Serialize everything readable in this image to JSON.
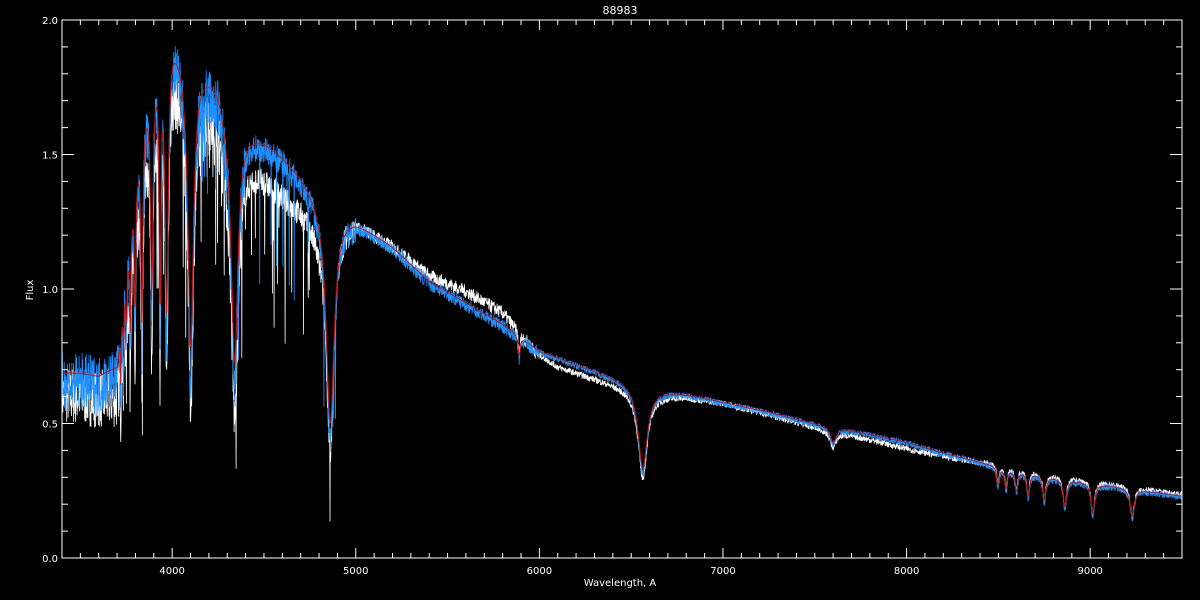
{
  "chart_data": {
    "type": "line",
    "title": "88983",
    "xlabel": "Wavelength, A",
    "ylabel": "Flux",
    "xlim": [
      3400,
      9500
    ],
    "ylim": [
      0.0,
      2.0
    ],
    "x_ticks": [
      4000,
      5000,
      6000,
      7000,
      8000,
      9000
    ],
    "x_tick_labels": [
      "4000",
      "5000",
      "6000",
      "7000",
      "8000",
      "9000"
    ],
    "y_ticks": [
      0.0,
      0.5,
      1.0,
      1.5,
      2.0
    ],
    "y_tick_labels": [
      "0.0",
      "0.5",
      "1.0",
      "1.5",
      "2.0"
    ],
    "x_minor_step": 100,
    "y_minor_step": 0.1,
    "grid": false,
    "colors": {
      "background": "#000000",
      "axes": "#ffffff"
    },
    "continuum": {
      "x": [
        3400,
        3500,
        3600,
        3700,
        3750,
        3800,
        3850,
        3900,
        3950,
        4000,
        4050,
        4100,
        4150,
        4200,
        4250,
        4300,
        4350,
        4400,
        4500,
        4600,
        4700,
        4800,
        4900,
        5000,
        5200,
        5400,
        5600,
        5800,
        6000,
        6200,
        6500,
        6600,
        6800,
        7000,
        7200,
        7500,
        7800,
        8000,
        8200,
        8500,
        8800,
        9000,
        9200,
        9500
      ],
      "y": [
        0.69,
        0.69,
        0.68,
        0.72,
        1.05,
        1.42,
        1.68,
        1.84,
        1.9,
        1.96,
        1.9,
        1.84,
        1.83,
        1.81,
        1.77,
        1.67,
        1.63,
        1.6,
        1.56,
        1.5,
        1.43,
        1.34,
        1.29,
        1.26,
        1.16,
        1.03,
        0.95,
        0.87,
        0.77,
        0.72,
        0.65,
        0.63,
        0.61,
        0.58,
        0.55,
        0.5,
        0.46,
        0.43,
        0.39,
        0.34,
        0.3,
        0.28,
        0.26,
        0.23
      ]
    },
    "series": [
      {
        "color": "#ffffff",
        "offset": {
          "x": [
            3400,
            3600,
            3800,
            4000,
            4200,
            4400,
            4600,
            4800,
            4850,
            4900,
            5200,
            5400,
            5600,
            5800,
            6000,
            6100,
            6500,
            7000,
            7500,
            8000,
            8500,
            9500
          ],
          "y": [
            -0.05,
            -0.05,
            -0.12,
            -0.1,
            -0.12,
            -0.12,
            -0.13,
            -0.1,
            -0.05,
            0,
            0.01,
            0.03,
            0.05,
            0.05,
            -0.01,
            -0.03,
            -0.02,
            0,
            -0.01,
            -0.02,
            0.01,
            0.01
          ]
        }
      },
      {
        "color": "#1e90ff",
        "offset": {
          "x": [
            3400,
            9500
          ],
          "y": [
            0.0,
            0.0
          ]
        }
      },
      {
        "color": "#c81414",
        "smooth": true
      }
    ],
    "absorption_lines": [
      {
        "x": 3720,
        "depth": 0.2,
        "width": 2
      },
      {
        "x": 3735,
        "depth": 0.25,
        "width": 2
      },
      {
        "x": 3750,
        "depth": 0.3,
        "width": 2
      },
      {
        "x": 3771,
        "depth": 0.4,
        "width": 3
      },
      {
        "x": 3798,
        "depth": 0.55,
        "width": 4
      },
      {
        "x": 3835,
        "depth": 0.75,
        "width": 6
      },
      {
        "x": 3889,
        "depth": 0.85,
        "width": 8
      },
      {
        "x": 3934,
        "depth": 1.0,
        "width": 5
      },
      {
        "x": 3970,
        "depth": 1.05,
        "width": 10
      },
      {
        "x": 4101,
        "depth": 1.1,
        "width": 18
      },
      {
        "x": 4340,
        "depth": 0.95,
        "width": 22
      },
      {
        "x": 4861,
        "depth": 0.85,
        "width": 26
      },
      {
        "x": 5890,
        "depth": 0.08,
        "width": 6
      },
      {
        "x": 6563,
        "depth": 0.32,
        "width": 30
      },
      {
        "x": 7600,
        "depth": 0.06,
        "width": 20
      },
      {
        "x": 8498,
        "depth": 0.07,
        "width": 8
      },
      {
        "x": 8542,
        "depth": 0.08,
        "width": 8
      },
      {
        "x": 8598,
        "depth": 0.08,
        "width": 9
      },
      {
        "x": 8662,
        "depth": 0.09,
        "width": 9
      },
      {
        "x": 8750,
        "depth": 0.1,
        "width": 10
      },
      {
        "x": 8862,
        "depth": 0.11,
        "width": 11
      },
      {
        "x": 9014,
        "depth": 0.12,
        "width": 12
      },
      {
        "x": 9229,
        "depth": 0.11,
        "width": 13
      }
    ]
  }
}
